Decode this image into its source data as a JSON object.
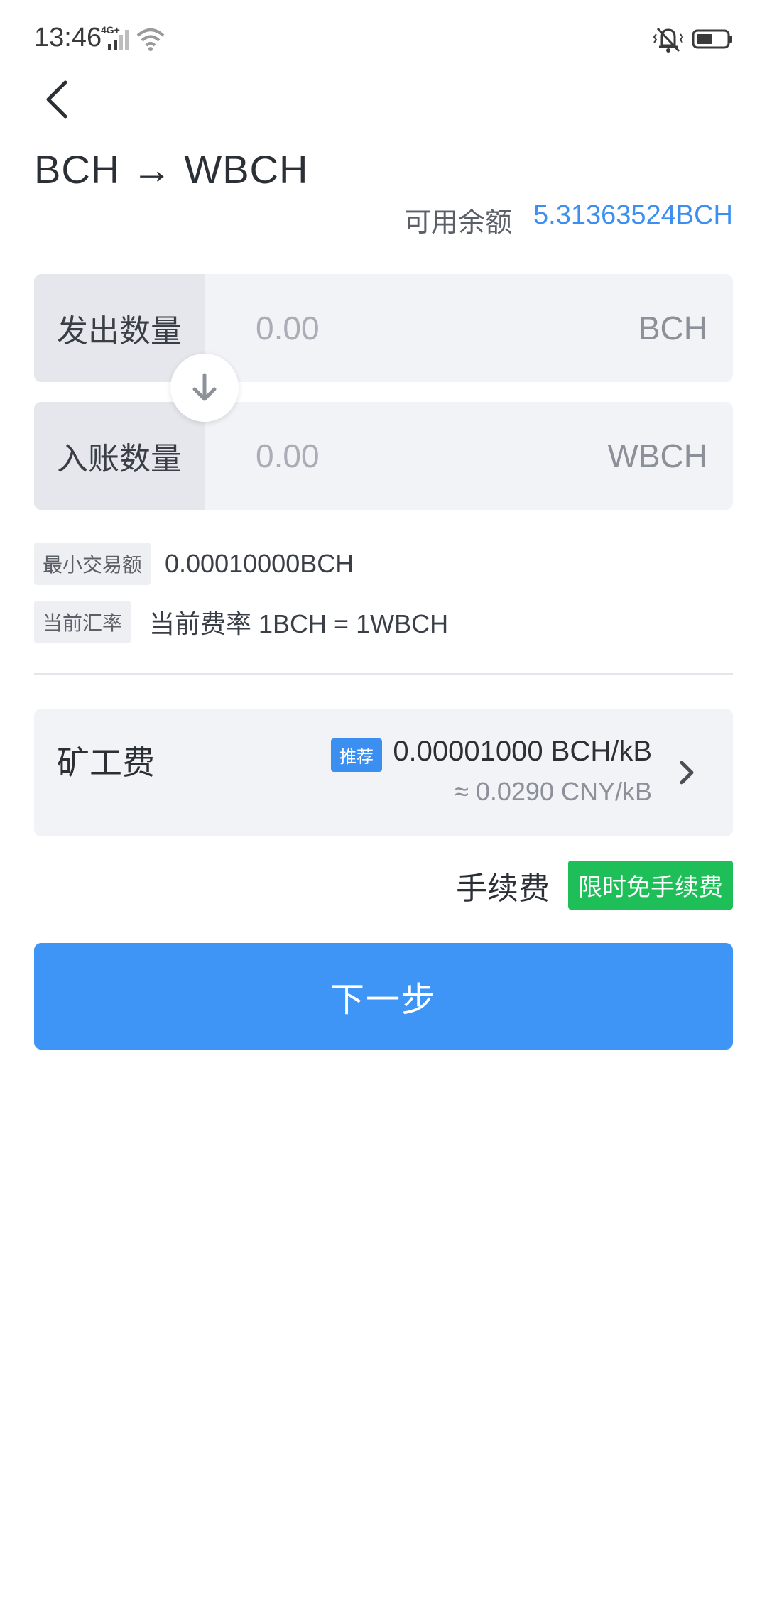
{
  "status_bar": {
    "time": "13:46",
    "network": "4G+"
  },
  "header": {
    "title": "BCH → WBCH",
    "back_icon": "chevron-left-icon"
  },
  "balance": {
    "label": "可用余额",
    "value": "5.31363524BCH"
  },
  "send": {
    "label": "发出数量",
    "placeholder": "0.00",
    "unit": "BCH"
  },
  "receive": {
    "label": "入账数量",
    "placeholder": "0.00",
    "unit": "WBCH"
  },
  "swap_icon": "arrow-down-icon",
  "min_trade": {
    "tag": "最小交易额",
    "value": "0.00010000BCH"
  },
  "rate": {
    "tag": "当前汇率",
    "value": "当前费率 1BCH = 1WBCH"
  },
  "miner_fee": {
    "title": "矿工费",
    "tag": "推荐",
    "value": "0.00001000 BCH/kB",
    "approx": "≈ 0.0290 CNY/kB"
  },
  "service_fee": {
    "label": "手续费",
    "badge": "限时免手续费"
  },
  "next_button": {
    "label": "下一步"
  },
  "colors": {
    "accent": "#3f95f6",
    "balance": "#3a8ff0",
    "badge_green": "#1ebe59"
  }
}
